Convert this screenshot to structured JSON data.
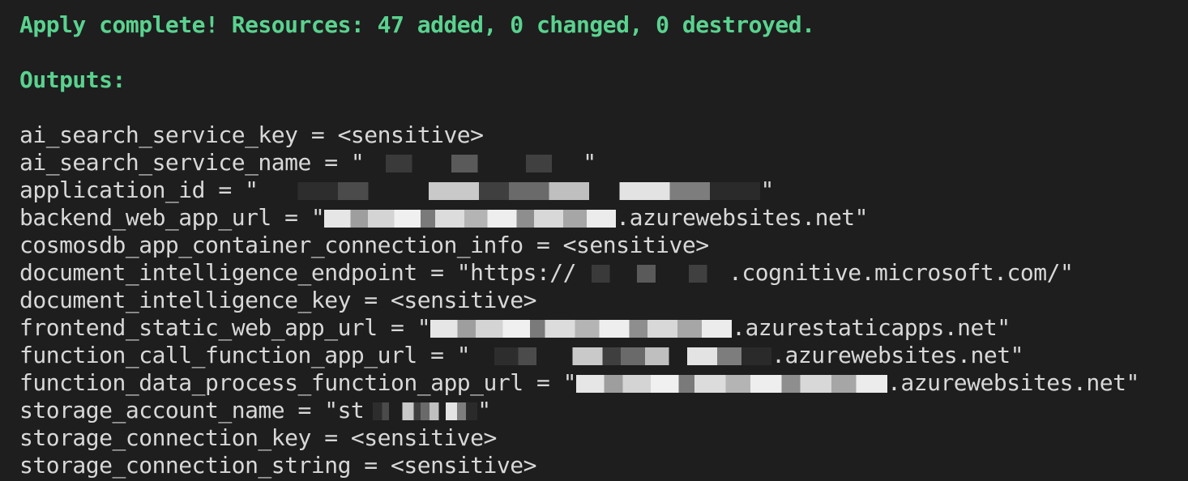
{
  "summary": "Apply complete! Resources: 47 added, 0 changed, 0 destroyed.",
  "outputs_header": "Outputs:",
  "outputs": [
    {
      "text": "ai_search_service_key = <sensitive>"
    },
    {
      "prefix": "ai_search_service_name = \"",
      "suffix": "\""
    },
    {
      "prefix": "application_id = \"",
      "suffix": "\""
    },
    {
      "prefix": "backend_web_app_url = \"",
      "suffix": ".azurewebsites.net\""
    },
    {
      "text": "cosmosdb_app_container_connection_info = <sensitive>"
    },
    {
      "prefix": "document_intelligence_endpoint = \"https://",
      "suffix": ".cognitive.microsoft.com/\""
    },
    {
      "text": "document_intelligence_key = <sensitive>"
    },
    {
      "prefix": "frontend_static_web_app_url = \"",
      "suffix": ".azurestaticapps.net\""
    },
    {
      "prefix": "function_call_function_app_url = \"",
      "suffix": ".azurewebsites.net\""
    },
    {
      "prefix": "function_data_process_function_app_url = \"",
      "suffix": ".azurewebsites.net\""
    },
    {
      "prefix": "storage_account_name = \"st",
      "suffix": "\""
    },
    {
      "text": "storage_connection_key = <sensitive>"
    },
    {
      "text": "storage_connection_string = <sensitive>"
    }
  ],
  "colors": {
    "background": "#1e1e1e",
    "success_text": "#5ad28f",
    "default_text": "#d8d8d8"
  }
}
